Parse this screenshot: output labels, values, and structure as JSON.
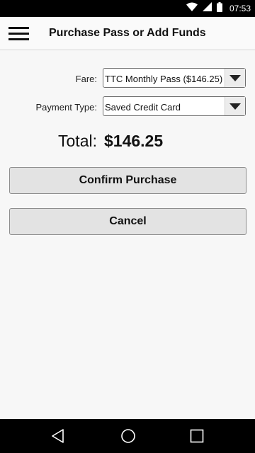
{
  "status_bar": {
    "time": "07:53",
    "icons": [
      "wifi-icon",
      "signal-icon",
      "battery-icon"
    ]
  },
  "app_bar": {
    "title": "Purchase Pass or Add Funds",
    "menu_icon": "hamburger-menu-icon"
  },
  "form": {
    "fare": {
      "label": "Fare:",
      "value": "TTC Monthly Pass ($146.25)"
    },
    "payment_type": {
      "label": "Payment Type:",
      "value": "Saved Credit Card"
    },
    "total": {
      "label": "Total:",
      "value": "$146.25"
    }
  },
  "actions": {
    "confirm_label": "Confirm Purchase",
    "cancel_label": "Cancel"
  },
  "nav_bar": {
    "icons": [
      "back-icon",
      "home-icon",
      "recents-icon"
    ]
  },
  "colors": {
    "background": "#f7f7f7",
    "button_fill": "#e3e3e3",
    "system_bars": "#000000"
  }
}
